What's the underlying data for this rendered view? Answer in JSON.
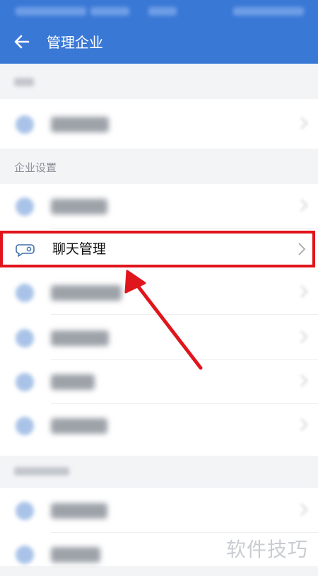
{
  "header": {
    "title": "管理企业"
  },
  "sections": {
    "enterprise_settings": "企业设置"
  },
  "highlighted_item": {
    "label": "聊天管理"
  },
  "watermark": "软件技巧",
  "colors": {
    "header": "#3a78d6",
    "highlight": "#e1141b"
  },
  "icons": {
    "back": "arrow-left-icon",
    "chat": "chat-bubble-icon",
    "chevron": "chevron-right-icon"
  }
}
